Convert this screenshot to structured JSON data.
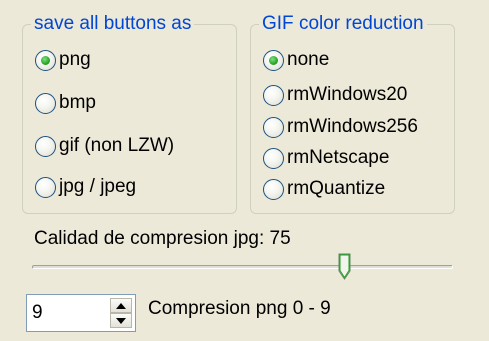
{
  "save_group": {
    "title": "save all buttons as",
    "options": [
      "png",
      "bmp",
      "gif (non LZW)",
      "jpg / jpeg"
    ],
    "selected_index": 0
  },
  "gif_group": {
    "title": "GIF color reduction",
    "options": [
      "none",
      "rmWindows20",
      "rmWindows256",
      "rmNetscape",
      "rmQuantize"
    ],
    "selected_index": 0
  },
  "jpg_quality": {
    "label": "Calidad de compresion jpg: 75",
    "value": 75,
    "min": 0,
    "max": 100
  },
  "png_compression": {
    "value": "9",
    "label": "Compresion png 0 - 9"
  },
  "colors": {
    "background": "#ece9d8",
    "group_title": "#0046d5",
    "radio_dot": "#2aa52a"
  }
}
